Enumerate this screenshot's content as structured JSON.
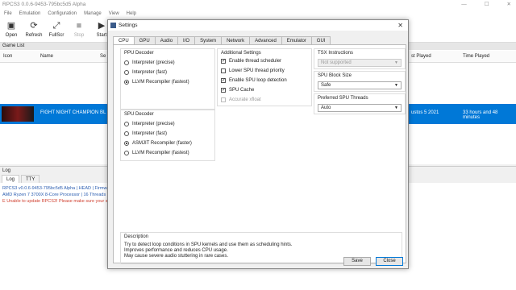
{
  "window": {
    "title": "RPCS3 0.0.6-9453-795bc5d5 Alpha",
    "min": "—",
    "max": "☐",
    "close": "✕"
  },
  "menu": [
    "File",
    "Emulation",
    "Configuration",
    "Manage",
    "View",
    "Help"
  ],
  "toolbar": [
    {
      "label": "Open",
      "icon": "▣",
      "disabled": false
    },
    {
      "label": "Refresh",
      "icon": "⟳",
      "disabled": false
    },
    {
      "label": "FullScr",
      "icon": "⤢",
      "disabled": false
    },
    {
      "label": "Stop",
      "icon": "■",
      "disabled": true
    },
    {
      "label": "Start",
      "icon": "▶",
      "disabled": false
    }
  ],
  "gamelist": {
    "title": "Game List",
    "columns": {
      "icon": "Icon",
      "name": "Name",
      "serial": "Se",
      "last_played": "st Played",
      "time_played": "Time Played"
    },
    "row": {
      "name": "FIGHT NIGHT CHAMPION",
      "serial": "BL",
      "last_played": "ustos 5 2021",
      "time_played": "33 hours and 48 minutes"
    }
  },
  "log": {
    "title": "Log",
    "tabs": [
      "Log",
      "TTY"
    ],
    "lines": [
      {
        "text": "RPCS3 v0.0.6-9453-795bc5d5 Alpha | HEAD | Firmwa",
        "color": "#2a5db0"
      },
      {
        "text": "AMD Ryzen 7 3700X 8-Core Processor | 16 Threads |",
        "color": "#2a5db0"
      },
      {
        "text": "E Unable to update RPCS3! Please make sure your sy",
        "color": "#d04030"
      }
    ]
  },
  "dialog": {
    "title": "Settings",
    "close": "✕",
    "tabs": [
      "CPU",
      "GPU",
      "Audio",
      "I/O",
      "System",
      "Network",
      "Advanced",
      "Emulator",
      "GUI"
    ],
    "ppu": {
      "title": "PPU Decoder",
      "options": [
        "Interpreter (precise)",
        "Interpreter (fast)",
        "LLVM Recompiler (fastest)"
      ],
      "selected": 2
    },
    "spu": {
      "title": "SPU Decoder",
      "options": [
        "Interpreter (precise)",
        "Interpreter (fast)",
        "ASMJIT Recompiler (faster)",
        "LLVM Recompiler (fastest)"
      ],
      "selected": 2
    },
    "additional": {
      "title": "Additional Settings",
      "items": [
        {
          "label": "Enable thread scheduler",
          "checked": true,
          "disabled": false
        },
        {
          "label": "Lower SPU thread priority",
          "checked": false,
          "disabled": false
        },
        {
          "label": "Enable SPU loop detection",
          "checked": true,
          "disabled": false
        },
        {
          "label": "SPU Cache",
          "checked": true,
          "disabled": false
        },
        {
          "label": "Accurate xfloat",
          "checked": false,
          "disabled": true
        }
      ]
    },
    "tsx": {
      "title": "TSX Instructions",
      "value": "Not supported"
    },
    "spu_block": {
      "title": "SPU Block Size",
      "value": "Safe"
    },
    "spu_threads": {
      "title": "Preferred SPU Threads",
      "value": "Auto"
    },
    "description": {
      "title": "Description",
      "lines": [
        "Try to detect loop conditions in SPU kernels and use them as scheduling hints.",
        "Improves performance and reduces CPU usage.",
        "May cause severe audio stuttering in rare cases."
      ]
    },
    "save_label": "Save",
    "close_label": "Close"
  }
}
